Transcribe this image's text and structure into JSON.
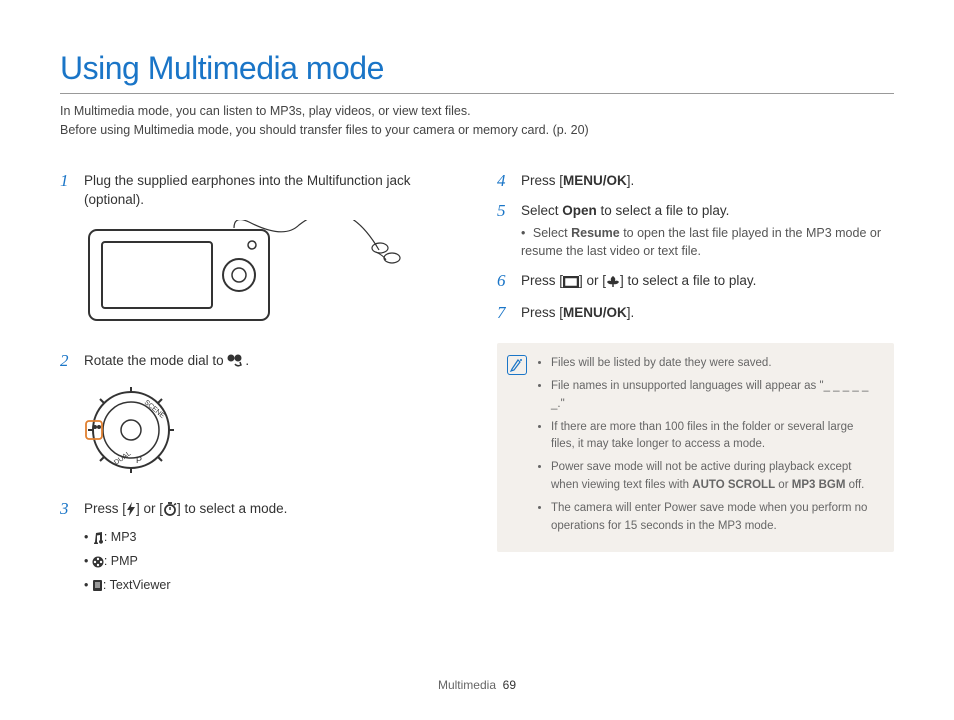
{
  "title": "Using Multimedia mode",
  "intro": {
    "line1": "In Multimedia mode, you can listen to MP3s, play videos, or view text files.",
    "line2": "Before using Multimedia mode, you should transfer files to your camera or memory card. (p. 20)"
  },
  "steps": {
    "s1": {
      "num": "1",
      "text": "Plug the supplied earphones into the Multifunction jack (optional)."
    },
    "s2": {
      "num": "2",
      "text_a": "Rotate the mode dial to ",
      "text_b": "."
    },
    "s3": {
      "num": "3",
      "text_a": "Press [",
      "text_b": "] or [",
      "text_c": "] to select a mode.",
      "items": {
        "mp3": ": MP3",
        "pmp": ": PMP",
        "txt": ": TextViewer"
      }
    },
    "s4": {
      "num": "4",
      "text_a": "Press [",
      "text_b": "MENU/OK",
      "text_c": "]."
    },
    "s5": {
      "num": "5",
      "text_a": "Select ",
      "text_b": "Open",
      "text_c": " to select a file to play.",
      "sub_a": "Select ",
      "sub_b": "Resume",
      "sub_c": " to open the last file played in the MP3 mode or resume the last video or text file."
    },
    "s6": {
      "num": "6",
      "text_a": "Press [",
      "text_b": "] or [",
      "text_c": "] to select a file to play."
    },
    "s7": {
      "num": "7",
      "text_a": "Press [",
      "text_b": "MENU/OK",
      "text_c": "]."
    }
  },
  "notes": {
    "n1": "Files will be listed by date they were saved.",
    "n2": "File names in unsupported languages will appear as \"_ _ _ _ _ _.\"",
    "n3": "If there are more than 100 files in the folder or several large files, it may take longer to access a mode.",
    "n4_a": "Power save mode will not be active during playback except when viewing text files with ",
    "n4_b": "AUTO SCROLL",
    "n4_c": " or ",
    "n4_d": "MP3 BGM",
    "n4_e": " off.",
    "n5": "The camera will enter Power save mode when you perform no operations for 15 seconds in the MP3 mode."
  },
  "footer": {
    "section": "Multimedia",
    "page": "69"
  }
}
